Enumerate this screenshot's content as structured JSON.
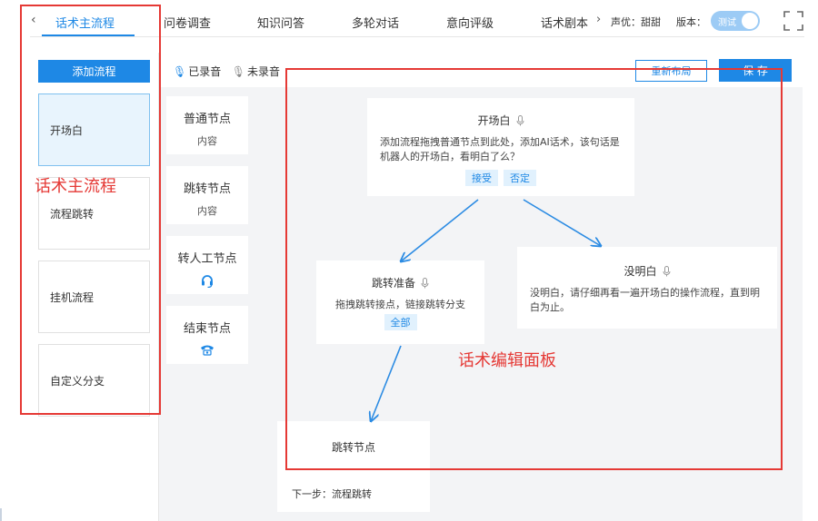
{
  "tabs": [
    {
      "label": "话术主流程",
      "active": true
    },
    {
      "label": "问卷调查"
    },
    {
      "label": "知识问答"
    },
    {
      "label": "多轮对话"
    },
    {
      "label": "意向评级"
    },
    {
      "label": "话术剧本"
    }
  ],
  "header": {
    "voice": "声优：甜甜",
    "version_label": "版本：",
    "toggle_label": "测试"
  },
  "left_panel": {
    "add_flow_label": "添加流程",
    "flows": [
      "开场白",
      "流程跳转",
      "挂机流程",
      "自定义分支"
    ]
  },
  "palette": {
    "recorded": "已录音",
    "unrecorded": "未录音",
    "nodes": [
      {
        "title": "普通节点",
        "sub": "内容"
      },
      {
        "title": "跳转节点",
        "sub": "内容"
      },
      {
        "title": "转人工节点"
      },
      {
        "title": "结束节点"
      }
    ]
  },
  "toolbar": {
    "relayout_label": "重新布局",
    "save_label": "保 存"
  },
  "canvas": {
    "node_opening": {
      "title": "开场白",
      "body": "添加流程拖拽普通节点到此处，添加AI话术，该句话是机器人的开场白，看明白了么？",
      "chips": [
        "接受",
        "否定"
      ]
    },
    "node_jump_prepare": {
      "title": "跳转准备",
      "body": "拖拽跳转接点，链接跳转分支",
      "chips": [
        "全部"
      ]
    },
    "node_not_understood": {
      "title": "没明白",
      "body": "没明白，请仔细再看一遍开场白的操作流程，直到明白为止。"
    },
    "node_jump": {
      "title": "跳转节点",
      "next_step": "下一步：流程跳转"
    }
  },
  "annotations": {
    "left_label": "话术主流程",
    "canvas_label": "话术编辑面板"
  },
  "colors": {
    "accent": "#1e88e5",
    "annotation": "#e53935",
    "chip_bg": "#e1f1fd",
    "canvas_bg": "#f3f4f6"
  }
}
